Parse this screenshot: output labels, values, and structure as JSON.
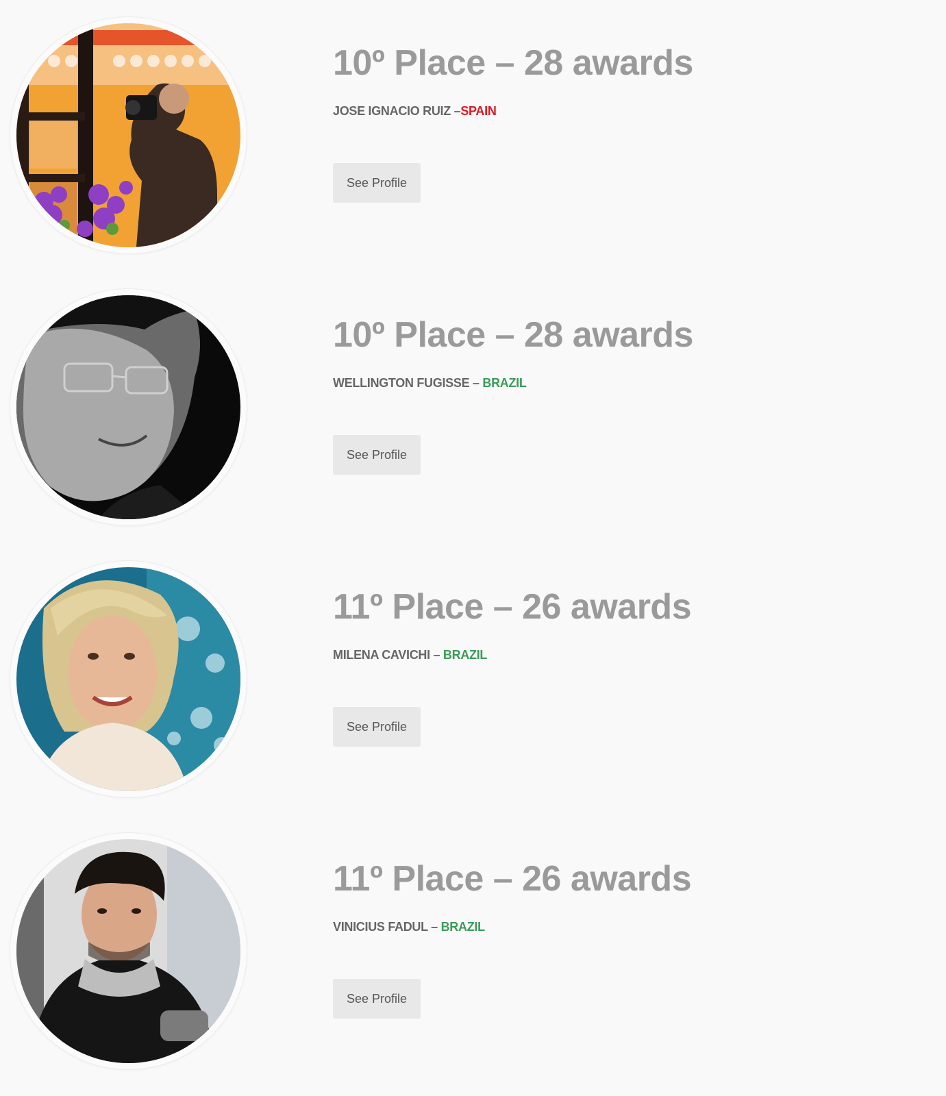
{
  "entries": [
    {
      "title": "10º Place – 28 awards",
      "name": "JOSE IGNACIO RUIZ –",
      "country": "SPAIN",
      "country_color": "#e0161f",
      "button_label": "See Profile",
      "photo": "photographer-with-camera-at-window-photo"
    },
    {
      "title": "10º Place – 28 awards",
      "name": "WELLINGTON FUGISSE – ",
      "country": "BRAZIL",
      "country_color": "#3b9a5a",
      "button_label": "See Profile",
      "photo": "man-with-glasses-bw-portrait-photo"
    },
    {
      "title": "11º Place – 26 awards",
      "name": "MILENA CAVICHI – ",
      "country": "BRAZIL",
      "country_color": "#3b9a5a",
      "button_label": "See Profile",
      "photo": "smiling-blonde-woman-portrait-photo"
    },
    {
      "title": "11º Place – 26 awards",
      "name": "VINICIUS FADUL – ",
      "country": "BRAZIL",
      "country_color": "#3b9a5a",
      "button_label": "See Profile",
      "photo": "man-in-black-jacket-portrait-photo"
    }
  ]
}
